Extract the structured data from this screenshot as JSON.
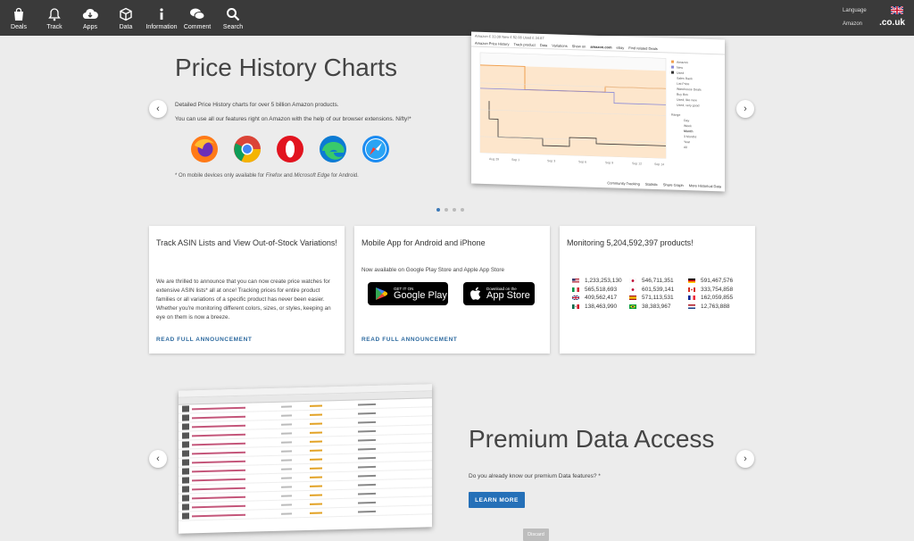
{
  "nav": {
    "items": [
      {
        "label": "Deals",
        "icon": "bag-icon"
      },
      {
        "label": "Track",
        "icon": "bell-icon"
      },
      {
        "label": "Apps",
        "icon": "cloud-download-icon"
      },
      {
        "label": "Data",
        "icon": "cube-icon"
      },
      {
        "label": "Information",
        "icon": "info-icon"
      },
      {
        "label": "Comment",
        "icon": "comment-icon"
      },
      {
        "label": "Search",
        "icon": "search-icon"
      }
    ],
    "language_label": "Language",
    "amazon_label": "Amazon",
    "domain": ".co.uk"
  },
  "hero": {
    "title": "Price History Charts",
    "text1": "Detailed Price History charts for over 5 billion Amazon products.",
    "text2": "You can use all our features right on Amazon with the help of our browser extensions. Nifty!*",
    "browsers": [
      "firefox-icon",
      "chrome-icon",
      "opera-icon",
      "edge-icon",
      "safari-icon"
    ],
    "footnote_prefix": "* On mobile devices only available for ",
    "footnote_firefox": "Firefox",
    "footnote_and": " and ",
    "footnote_edge": "Microsoft Edge",
    "footnote_suffix": " for Android.",
    "chart_shot": {
      "head": "Amazon  £ 33.09   New  £ 52.08   Used  £ 34.87",
      "tabs": [
        "Amazon Price History",
        "Track product",
        "Data",
        "Variations",
        "Show on",
        "amazon.com",
        "ebay",
        "Find related Deals"
      ],
      "footer": [
        "Community Tracking",
        "Statistic",
        "Share Graph",
        "More Historical Data"
      ]
    }
  },
  "cards": [
    {
      "title": "Track ASIN Lists and View Out-of-Stock Variations!",
      "text": "We are thrilled to announce that you can now create price watches for extensive ASIN lists* all at once! Tracking prices for entire product families or all variations of a specific product has never been easier. Whether you're monitoring different colors, sizes, or styles, keeping an eye on them is now a breeze.",
      "link": "READ FULL ANNOUNCEMENT"
    },
    {
      "title": "Mobile App for Android and iPhone",
      "text": "Now available on Google Play Store and Apple App Store",
      "google_small": "GET IT ON",
      "google_big": "Google Play",
      "apple_small": "Download on the",
      "apple_big": "App Store",
      "link": "READ FULL ANNOUNCEMENT"
    },
    {
      "title": "Monitoring 5,204,592,397 products!",
      "stats": [
        {
          "flag": "us",
          "value": "1,233,253,130"
        },
        {
          "flag": "jp",
          "value": "546,711,351"
        },
        {
          "flag": "de",
          "value": "591,467,576"
        },
        {
          "flag": "it",
          "value": "565,518,693"
        },
        {
          "flag": "jp",
          "value": "601,539,141"
        },
        {
          "flag": "ca",
          "value": "333,754,858"
        },
        {
          "flag": "uk",
          "value": "409,562,417"
        },
        {
          "flag": "es",
          "value": "571,113,531"
        },
        {
          "flag": "fr",
          "value": "162,059,855"
        },
        {
          "flag": "mx",
          "value": "138,463,990"
        },
        {
          "flag": "br",
          "value": "38,383,967"
        },
        {
          "flag": "nl",
          "value": "12,763,888"
        }
      ]
    }
  ],
  "premium": {
    "title": "Premium Data Access",
    "text": "Do you already know our premium Data features? *",
    "button": "LEARN MORE",
    "discard": "Discard"
  }
}
